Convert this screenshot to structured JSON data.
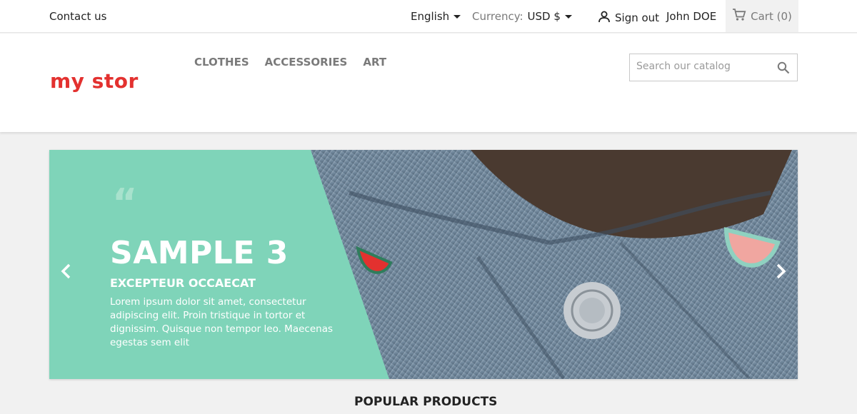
{
  "topbar": {
    "contact": "Contact us",
    "language": "English",
    "currency_label": "Currency:",
    "currency_value": "USD $",
    "signout": "Sign out",
    "user": "John DOE",
    "cart": "Cart (0)"
  },
  "header": {
    "logo": "my stor",
    "nav": [
      "CLOTHES",
      "ACCESSORIES",
      "ART"
    ],
    "search_placeholder": "Search our catalog"
  },
  "hero": {
    "title": "SAMPLE 3",
    "subtitle": "EXCEPTEUR OCCAECAT",
    "text": "Lorem ipsum dolor sit amet, consectetur adipiscing elit. Proin tristique in tortor et dignissim. Quisque non tempor leo. Maecenas egestas sem elit",
    "accent_color": "#7fd4b9"
  },
  "section": {
    "popular": "POPULAR PRODUCTS"
  },
  "colors": {
    "brand": "#e3312f",
    "accent": "#7fd4b9"
  }
}
